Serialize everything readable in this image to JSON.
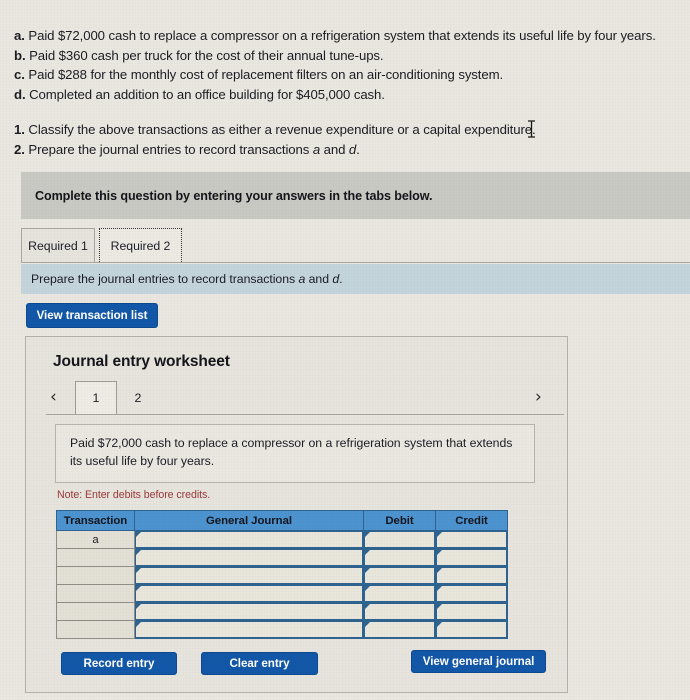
{
  "problem": {
    "items": [
      {
        "marker": "a.",
        "text": "Paid $72,000 cash to replace a compressor on a refrigeration system that extends its useful life by four years."
      },
      {
        "marker": "b.",
        "text": "Paid $360 cash per truck for the cost of their annual tune-ups."
      },
      {
        "marker": "c.",
        "text": "Paid $288 for the monthly cost of replacement filters on an air-conditioning system."
      },
      {
        "marker": "d.",
        "text": "Completed an addition to an office building for $405,000 cash."
      }
    ],
    "requirements": [
      {
        "marker": "1.",
        "text": "Classify the above transactions as either a revenue expenditure or a capital expenditure."
      },
      {
        "marker": "2.",
        "text": "Prepare the journal entries to record transactions a and d."
      }
    ]
  },
  "banner": {
    "complete_text": "Complete this question by entering your answers in the tabs below."
  },
  "tabs": {
    "items": [
      {
        "label": "Required 1",
        "active": false
      },
      {
        "label": "Required 2",
        "active": true
      }
    ]
  },
  "sub_banner": {
    "text": "Prepare the journal entries to record transactions a and d."
  },
  "toolbar": {
    "view_transaction_list_label": "View transaction list"
  },
  "worksheet": {
    "title": "Journal entry worksheet",
    "pager": {
      "prev_icon": "chevron-left",
      "next_icon": "chevron-right",
      "pages": [
        {
          "label": "1",
          "active": true
        },
        {
          "label": "2",
          "active": false
        }
      ]
    },
    "description": "Paid $72,000 cash to replace a compressor on a refrigeration system that extends its useful life by four years.",
    "note": "Note: Enter debits before credits.",
    "table": {
      "columns": [
        "Transaction",
        "General Journal",
        "Debit",
        "Credit"
      ],
      "rows": [
        {
          "transaction": "a",
          "general_journal": "",
          "debit": "",
          "credit": ""
        },
        {
          "transaction": "",
          "general_journal": "",
          "debit": "",
          "credit": ""
        },
        {
          "transaction": "",
          "general_journal": "",
          "debit": "",
          "credit": ""
        },
        {
          "transaction": "",
          "general_journal": "",
          "debit": "",
          "credit": ""
        },
        {
          "transaction": "",
          "general_journal": "",
          "debit": "",
          "credit": ""
        },
        {
          "transaction": "",
          "general_journal": "",
          "debit": "",
          "credit": ""
        }
      ]
    },
    "buttons": {
      "record_entry": "Record entry",
      "clear_entry": "Clear entry",
      "view_general_journal": "View general journal"
    }
  },
  "colors": {
    "page_background": "#e9e7e0",
    "primary_button": "#1257a8",
    "table_header": "#4c93cf",
    "sub_banner": "#c3d4db",
    "complete_banner": "#c9c9c3",
    "note_text": "#9a3a3a"
  }
}
